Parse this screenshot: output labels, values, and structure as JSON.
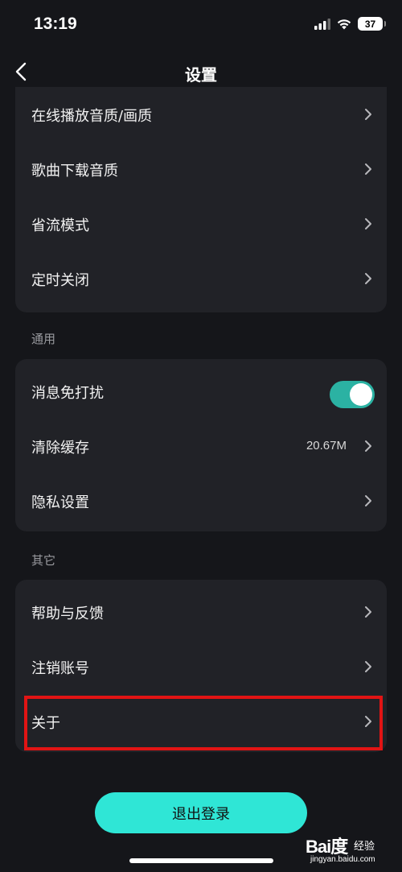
{
  "status_bar": {
    "time": "13:19",
    "battery": "37"
  },
  "nav": {
    "title": "设置"
  },
  "group_playback": {
    "items": [
      {
        "label": "在线播放音质/画质"
      },
      {
        "label": "歌曲下载音质"
      },
      {
        "label": "省流模式"
      },
      {
        "label": "定时关闭"
      }
    ]
  },
  "section_general": {
    "title": "通用",
    "dnd_label": "消息免打扰",
    "dnd_enabled": true,
    "cache_label": "清除缓存",
    "cache_value": "20.67M",
    "privacy_label": "隐私设置"
  },
  "section_other": {
    "title": "其它",
    "items": [
      {
        "label": "帮助与反馈"
      },
      {
        "label": "注销账号"
      },
      {
        "label": "关于"
      }
    ]
  },
  "logout": {
    "label": "退出登录"
  },
  "watermark": {
    "brand": "Bai度",
    "sub": "经验",
    "url": "jingyan.baidu.com"
  },
  "colors": {
    "background": "#15161a",
    "card": "#212227",
    "toggle_on": "#2bb2a3",
    "logout_button": "#2fe6d6",
    "highlight": "#e11414"
  }
}
